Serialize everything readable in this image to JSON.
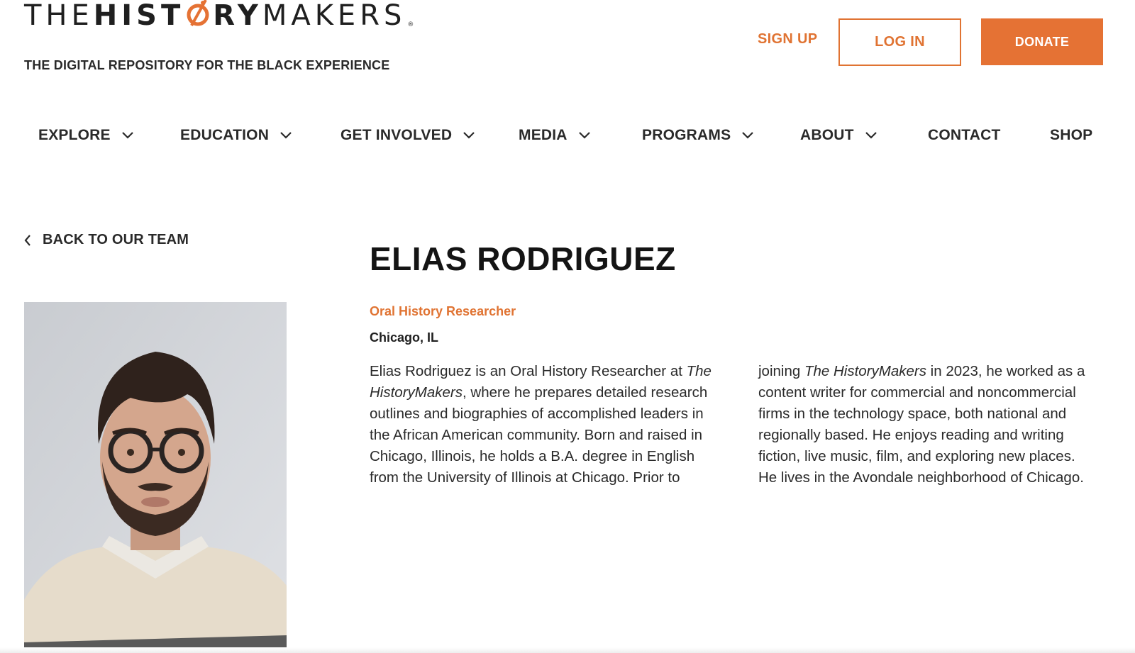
{
  "header": {
    "logo": {
      "part1": "THE",
      "part2": "HIST",
      "part3": "RY",
      "part4": "MAKERS",
      "reg": "®"
    },
    "tagline": "THE DIGITAL REPOSITORY FOR THE BLACK EXPERIENCE",
    "signup_label": "SIGN UP",
    "login_label": "LOG IN",
    "donate_label": "DONATE"
  },
  "nav": {
    "items": [
      {
        "label": "EXPLORE",
        "has_dropdown": true
      },
      {
        "label": "EDUCATION",
        "has_dropdown": true
      },
      {
        "label": "GET INVOLVED",
        "has_dropdown": true
      },
      {
        "label": "MEDIA",
        "has_dropdown": true
      },
      {
        "label": "PROGRAMS",
        "has_dropdown": true
      },
      {
        "label": "ABOUT",
        "has_dropdown": true
      },
      {
        "label": "CONTACT",
        "has_dropdown": false
      },
      {
        "label": "SHOP",
        "has_dropdown": false
      }
    ]
  },
  "back_link": {
    "label": "BACK TO OUR TEAM",
    "icon": "chevron-left-icon"
  },
  "profile": {
    "name": "ELIAS RODRIGUEZ",
    "role": "Oral History Researcher",
    "location": "Chicago, IL",
    "bio_col1": [
      [
        "Elias Rodriguez is an Oral History Researcher at ",
        "The"
      ],
      [
        "",
        "HistoryMakers",
        ", where he prepares detailed research"
      ],
      [
        "outlines and biographies of accomplished leaders in"
      ],
      [
        "the African American community. Born and raised in"
      ],
      [
        "Chicago, Illinois, he holds a B.A. degree in English"
      ],
      [
        "from the University of Illinois at Chicago. Prior to"
      ]
    ],
    "bio_col2": [
      [
        "joining ",
        "The HistoryMakers",
        " in 2023, he worked as a"
      ],
      [
        "content writer for commercial and noncommercial"
      ],
      [
        "firms in the technology space, both national and"
      ],
      [
        "regionally based. He enjoys reading and writing"
      ],
      [
        "fiction, live music, film, and exploring new places."
      ],
      [
        "He lives in the Avondale neighborhood of Chicago."
      ]
    ]
  },
  "colors": {
    "accent": "#e57234",
    "text": "#1f1f1f",
    "background": "#ffffff"
  }
}
